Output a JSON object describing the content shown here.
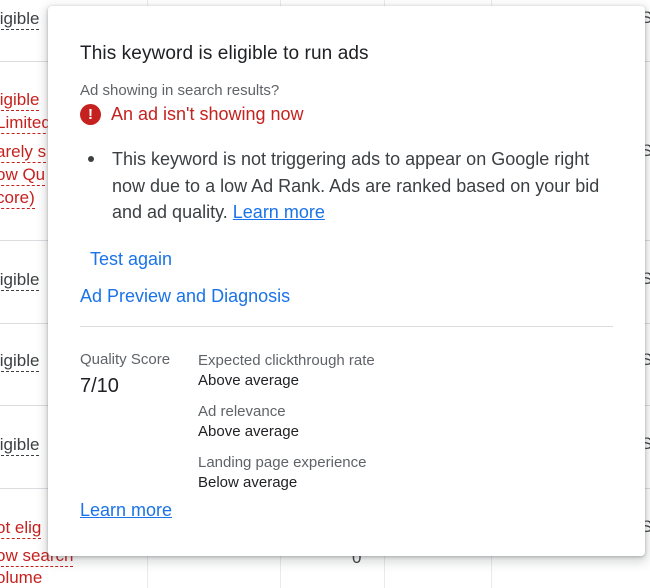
{
  "background": {
    "rows": [
      {
        "text": "ligible",
        "tone": "neutral"
      },
      {
        "text": "ligible",
        "tone": "alert"
      },
      {
        "text": "Limited",
        "tone": "alert"
      },
      {
        "text": "arely s",
        "tone": "alert"
      },
      {
        "text": "ow Qu",
        "tone": "alert"
      },
      {
        "text": "core)",
        "tone": "alert"
      },
      {
        "text": "ligible",
        "tone": "neutral"
      },
      {
        "text": "ligible",
        "tone": "neutral"
      },
      {
        "text": "ligible",
        "tone": "neutral"
      },
      {
        "text": "ot elig",
        "tone": "alert"
      },
      {
        "text": "ow search",
        "tone": "alert"
      },
      {
        "text": "olume",
        "tone": "alert"
      }
    ],
    "right_edge_letter": "S",
    "zero_value": "0"
  },
  "popover": {
    "title": "This keyword is eligible to run ads",
    "subhead": "Ad showing in search results?",
    "status_icon": "exclamation-icon",
    "status_text": "An ad isn't showing now",
    "bullet_text": "This keyword is not triggering ads to appear on Google right now due to a low Ad Rank. Ads are ranked based on your bid and ad quality.",
    "bullet_link": "Learn more",
    "test_again": "Test again",
    "ad_preview": "Ad Preview and Diagnosis",
    "quality_score_label": "Quality Score",
    "quality_score_value": "7/10",
    "metrics": [
      {
        "name": "Expected clickthrough rate",
        "value": "Above average"
      },
      {
        "name": "Ad relevance",
        "value": "Above average"
      },
      {
        "name": "Landing page experience",
        "value": "Below average"
      }
    ],
    "bottom_link": "Learn more"
  },
  "colors": {
    "alert": "#c5221f",
    "link": "#1a73e8",
    "text": "#202124",
    "secondary": "#5f6368"
  }
}
